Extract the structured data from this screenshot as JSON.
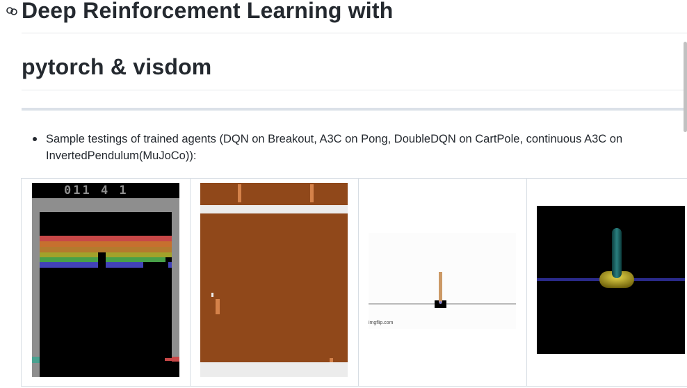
{
  "heading": {
    "line1": "Deep Reinforcement Learning with",
    "line2": "pytorch & visdom"
  },
  "content": {
    "bullet_text": "Sample testings of trained agents (DQN on Breakout, A3C on Pong, DoubleDQN on CartPole, continuous A3C on InvertedPendulum(MuJoCo)):"
  },
  "media": {
    "breakout": {
      "score": "011 4 1"
    },
    "cartpole": {
      "watermark": "imgflip.com"
    }
  },
  "icons": {
    "anchor": "link-icon"
  },
  "colors": {
    "text": "#24292f",
    "breakout_bg": "#000000",
    "breakout_wall": "#8e8e8e",
    "pong_bg": "#90481a",
    "pong_bar": "#ececec",
    "pong_paddle": "#d5824a",
    "cartpole_bg": "#fcfcfc",
    "mujoco_bg": "#000000",
    "mujoco_pole": "#1f6a6a",
    "mujoco_base": "#c4b414",
    "mujoco_rail": "#3a3a9e"
  }
}
